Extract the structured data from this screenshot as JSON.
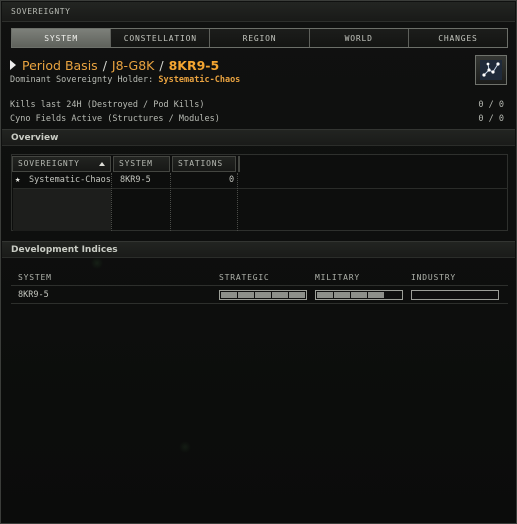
{
  "window": {
    "title": "SOVEREIGNTY"
  },
  "tabs": [
    {
      "label": "SYSTEM",
      "active": true
    },
    {
      "label": "CONSTELLATION",
      "active": false
    },
    {
      "label": "REGION",
      "active": false
    },
    {
      "label": "WORLD",
      "active": false
    },
    {
      "label": "CHANGES",
      "active": false
    }
  ],
  "breadcrumb": {
    "region": "Period Basis",
    "constellation": "J8-G8K",
    "system": "8KR9-5",
    "separator": "/"
  },
  "holder": {
    "label": "Dominant Sovereignty Holder:",
    "name": "Systematic-Chaos"
  },
  "map_button": {
    "icon": "star-map-icon"
  },
  "stats": [
    {
      "label": "Kills last 24H (Destroyed / Pod Kills)",
      "value": "0 / 0"
    },
    {
      "label": "Cyno Fields Active (Structures / Modules)",
      "value": "0 / 0"
    }
  ],
  "overview": {
    "title": "Overview",
    "columns": [
      "SOVEREIGNTY",
      "SYSTEM",
      "STATIONS"
    ],
    "rows": [
      {
        "sovereignty": "Systematic-Chaos",
        "system": "8KR9-5",
        "stations": "0",
        "icon": "star-icon"
      }
    ]
  },
  "development": {
    "title": "Development Indices",
    "columns": [
      "SYSTEM",
      "STRATEGIC",
      "MILITARY",
      "INDUSTRY"
    ],
    "rows": [
      {
        "system": "8KR9-5",
        "strategic_level": 5,
        "military_level": 4,
        "industry_level": 0,
        "max_level": 5
      }
    ]
  },
  "colors": {
    "accent": "#f4a531",
    "panel": "#0b0c0b",
    "tab_active": "#6f726c"
  }
}
